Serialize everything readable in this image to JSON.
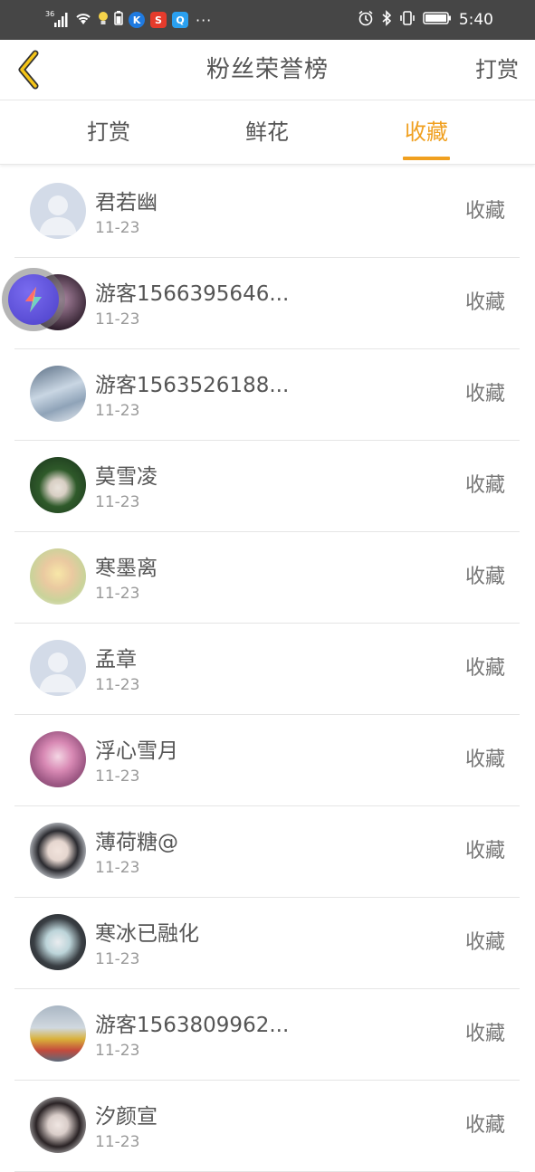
{
  "status_bar": {
    "signal_label": "36",
    "time": "5:40",
    "dots": "···",
    "app_icons": [
      "bulb-icon",
      "battery-small-icon",
      "k-app-icon",
      "s-app-icon",
      "q-app-icon"
    ]
  },
  "header": {
    "title": "粉丝荣誉榜",
    "right_action": "打赏"
  },
  "tabs": [
    {
      "label": "打赏",
      "active": false
    },
    {
      "label": "鲜花",
      "active": false
    },
    {
      "label": "收藏",
      "active": true
    }
  ],
  "colors": {
    "accent": "#f0a020",
    "status_bar_bg": "#464646",
    "text_primary": "#555555",
    "text_secondary": "#999999"
  },
  "fans": [
    {
      "name": "君若幽",
      "date": "11-23",
      "action": "收藏",
      "avatar": "default"
    },
    {
      "name": "游客1566395646...",
      "date": "11-23",
      "action": "收藏",
      "avatar": "photo"
    },
    {
      "name": "游客1563526188...",
      "date": "11-23",
      "action": "收藏",
      "avatar": "photo"
    },
    {
      "name": "莫雪凌",
      "date": "11-23",
      "action": "收藏",
      "avatar": "photo"
    },
    {
      "name": "寒墨离",
      "date": "11-23",
      "action": "收藏",
      "avatar": "photo"
    },
    {
      "name": "孟章",
      "date": "11-23",
      "action": "收藏",
      "avatar": "default"
    },
    {
      "name": "浮心雪月",
      "date": "11-23",
      "action": "收藏",
      "avatar": "photo"
    },
    {
      "name": "薄荷糖@",
      "date": "11-23",
      "action": "收藏",
      "avatar": "photo"
    },
    {
      "name": "寒冰已融化",
      "date": "11-23",
      "action": "收藏",
      "avatar": "photo"
    },
    {
      "name": "游客1563809962...",
      "date": "11-23",
      "action": "收藏",
      "avatar": "photo"
    },
    {
      "name": "汐颜宣",
      "date": "11-23",
      "action": "收藏",
      "avatar": "photo"
    }
  ]
}
